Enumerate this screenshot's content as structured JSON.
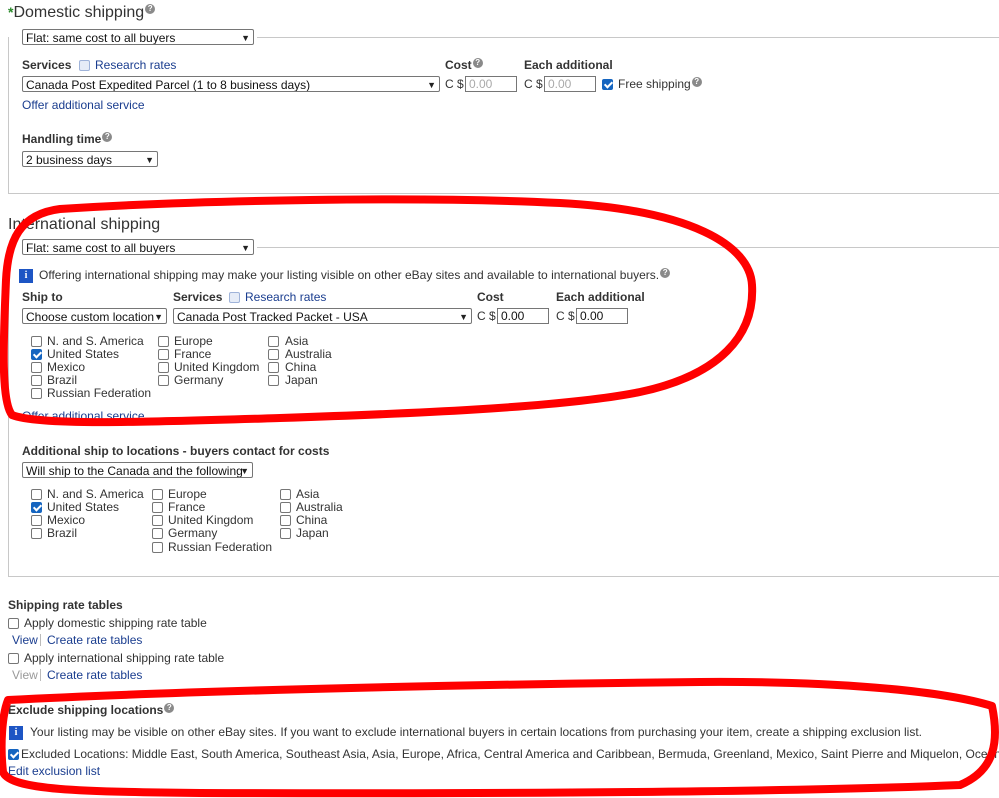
{
  "domestic": {
    "title": "Domestic shipping",
    "required_mark": "*",
    "type_select": "Flat: same cost to all buyers",
    "services_label": "Services",
    "research_rates": "Research rates",
    "service_select": "Canada Post Expedited Parcel (1 to 8 business days)",
    "cost_label": "Cost",
    "each_additional_label": "Each additional",
    "currency": "C $",
    "cost_placeholder": "0.00",
    "each_additional_placeholder": "0.00",
    "free_shipping_label": "Free shipping",
    "free_shipping_checked": true,
    "offer_additional": "Offer additional service",
    "handling_label": "Handling time",
    "handling_select": "2 business days"
  },
  "international": {
    "title": "International shipping",
    "type_select": "Flat: same cost to all buyers",
    "notice": "Offering international shipping may make your listing visible on other eBay sites and available to international buyers.",
    "ship_to_label": "Ship to",
    "ship_to_select": "Choose custom location",
    "services_label": "Services",
    "research_rates": "Research rates",
    "service_select": "Canada Post Tracked Packet - USA",
    "cost_label": "Cost",
    "each_additional_label": "Each additional",
    "currency": "C $",
    "cost_value": "0.00",
    "each_additional_value": "0.00",
    "locations": [
      {
        "label": "N. and S. America",
        "checked": false
      },
      {
        "label": "United States",
        "checked": true
      },
      {
        "label": "Mexico",
        "checked": false
      },
      {
        "label": "Brazil",
        "checked": false
      },
      {
        "label": "Russian Federation",
        "checked": false
      },
      {
        "label": "Europe",
        "checked": false
      },
      {
        "label": "France",
        "checked": false
      },
      {
        "label": "United Kingdom",
        "checked": false
      },
      {
        "label": "Germany",
        "checked": false
      },
      {
        "label": "Asia",
        "checked": false
      },
      {
        "label": "Australia",
        "checked": false
      },
      {
        "label": "China",
        "checked": false
      },
      {
        "label": "Japan",
        "checked": false
      }
    ],
    "offer_additional": "Offer additional service"
  },
  "additional": {
    "title": "Additional ship to locations - buyers contact for costs",
    "select": "Will ship to the Canada and the following",
    "locations": [
      {
        "label": "N. and S. America",
        "checked": false
      },
      {
        "label": "United States",
        "checked": true
      },
      {
        "label": "Mexico",
        "checked": false
      },
      {
        "label": "Brazil",
        "checked": false
      },
      {
        "label": "Europe",
        "checked": false
      },
      {
        "label": "France",
        "checked": false
      },
      {
        "label": "United Kingdom",
        "checked": false
      },
      {
        "label": "Germany",
        "checked": false
      },
      {
        "label": "Russian Federation",
        "checked": false
      },
      {
        "label": "Asia",
        "checked": false
      },
      {
        "label": "Australia",
        "checked": false
      },
      {
        "label": "China",
        "checked": false
      },
      {
        "label": "Japan",
        "checked": false
      }
    ]
  },
  "rate_tables": {
    "title": "Shipping rate tables",
    "domestic_label": "Apply domestic shipping rate table",
    "international_label": "Apply international shipping rate table",
    "view": "View",
    "create": "Create rate tables"
  },
  "exclude": {
    "title": "Exclude shipping locations",
    "notice": "Your listing may be visible on other eBay sites. If you want to exclude international buyers in certain locations from purchasing your item, create a shipping exclusion list.",
    "excluded_text": "Excluded Locations: Middle East, South America, Southeast Asia, Asia, Europe, Africa, Central America and Caribbean, Bermuda, Greenland, Mexico, Saint Pierre and Miquelon, Oceania",
    "excluded_checked": true,
    "edit_link": "Edit exclusion list"
  },
  "annotation_color": "#ff0000",
  "accent_color": "#1d55c4"
}
